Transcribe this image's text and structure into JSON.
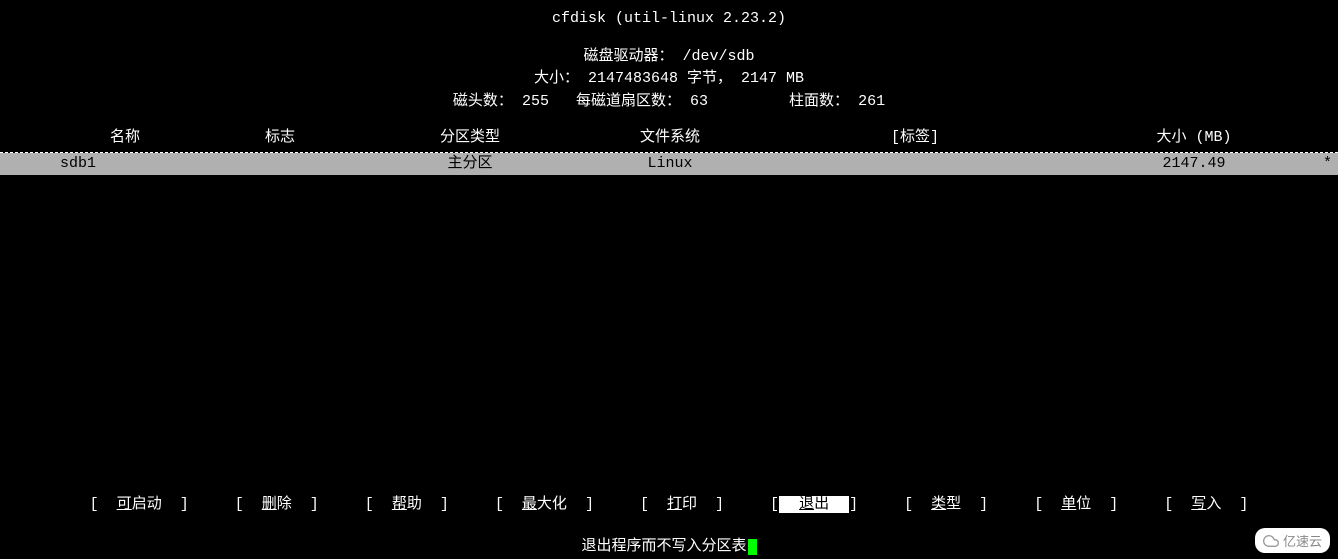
{
  "header": {
    "title": "cfdisk (util-linux 2.23.2)",
    "drive_label": "磁盘驱动器：",
    "drive_value": "/dev/sdb",
    "size_label": "大小：",
    "size_bytes": "2147483648",
    "size_bytes_unit": "字节，",
    "size_mb": "2147 MB",
    "heads_label": "磁头数：",
    "heads_value": "255",
    "sectors_label": "每磁道扇区数：",
    "sectors_value": "63",
    "cylinders_label": "柱面数：",
    "cylinders_value": "261"
  },
  "columns": {
    "name": "名称",
    "flags": "标志",
    "part_type": "分区类型",
    "fs_type": "文件系统",
    "label": "[标签]",
    "size": "大小 (MB)"
  },
  "rows": [
    {
      "name": "sdb1",
      "flags": "",
      "part_type": "主分区",
      "fs_type": "Linux",
      "label": "",
      "size": "2147.49",
      "marker": "*"
    }
  ],
  "menu": {
    "items": [
      {
        "id": "bootable",
        "lb": "[",
        "hot": "可",
        "rest": "启动",
        "rb": "]",
        "selected": false
      },
      {
        "id": "delete",
        "lb": "[",
        "hot": "删",
        "rest": "除",
        "rb": "]",
        "selected": false
      },
      {
        "id": "help",
        "lb": "[",
        "hot": "帮",
        "rest": "助",
        "rb": "]",
        "selected": false
      },
      {
        "id": "maximize",
        "lb": "[",
        "hot": "最",
        "rest": "大化",
        "rb": "]",
        "selected": false
      },
      {
        "id": "print",
        "lb": "[",
        "hot": "打",
        "rest": "印",
        "rb": "]",
        "selected": false
      },
      {
        "id": "quit",
        "lb": "[",
        "hot": "退",
        "rest": "出",
        "rb": "]",
        "selected": true
      },
      {
        "id": "type",
        "lb": "[",
        "hot": "类",
        "rest": "型",
        "rb": "]",
        "selected": false
      },
      {
        "id": "units",
        "lb": "[",
        "hot": "单",
        "rest": "位",
        "rb": "]",
        "selected": false
      },
      {
        "id": "write",
        "lb": "[",
        "hot": "写",
        "rest": "入",
        "rb": "]",
        "selected": false
      }
    ]
  },
  "status": {
    "text": "退出程序而不写入分区表"
  },
  "watermark": {
    "text": "亿速云"
  }
}
